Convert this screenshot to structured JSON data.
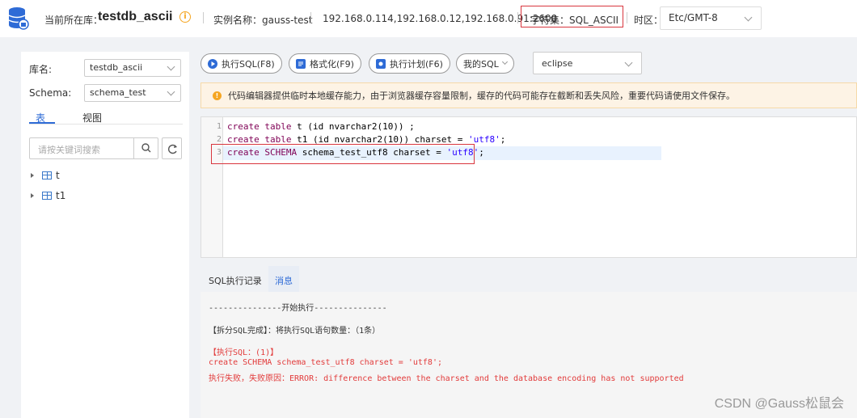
{
  "header": {
    "current_db_label": "当前所在库：",
    "current_db_value": "testdb_ascii",
    "instance_label": "实例名称：gauss-test",
    "hosts": "192.168.0.114,192.168.0.12,192.168.0.91:2600",
    "charset_label": "字符集：SQL_ASCII",
    "timezone_label": "时区：",
    "timezone_value": "Etc/GMT-8"
  },
  "sidebar": {
    "db_label": "库名:",
    "db_value": "testdb_ascii",
    "schema_label": "Schema:",
    "schema_value": "schema_test",
    "tabs": [
      {
        "label": "表"
      },
      {
        "label": "视图"
      }
    ],
    "search_placeholder": "请按关键词搜索",
    "tables": [
      {
        "name": "t"
      },
      {
        "name": "t1"
      }
    ]
  },
  "toolbar": {
    "execute": "执行SQL(F8)",
    "format": "格式化(F9)",
    "plan": "执行计划(F6)",
    "my_sql": "我的SQL",
    "theme": "eclipse"
  },
  "warning": "代码编辑器提供临时本地缓存能力，由于浏览器缓存容量限制，缓存的代码可能存在截断和丢失风险，重要代码请使用文件保存。",
  "editor": {
    "lines": [
      {
        "num": "1"
      },
      {
        "num": "2"
      },
      {
        "num": "3"
      }
    ]
  },
  "bottom": {
    "tabs": [
      {
        "label": "SQL执行记录"
      },
      {
        "label": "消息"
      }
    ],
    "messages": [
      "---------------开始执行---------------",
      "【拆分SQL完成】：将执行SQL语句数量：（1条）",
      "【执行SQL：(1)】",
      "create SCHEMA schema_test_utf8 charset = 'utf8';",
      "执行失败，失败原因：ERROR: difference between the charset and the database encoding has not supported"
    ]
  },
  "watermark": "CSDN @Gauss松鼠会",
  "colors": {
    "accent": "#2e6bd6",
    "error": "#e23b3b",
    "highlight_box": "#d9363e",
    "warning_bg": "#fdf3e5"
  }
}
